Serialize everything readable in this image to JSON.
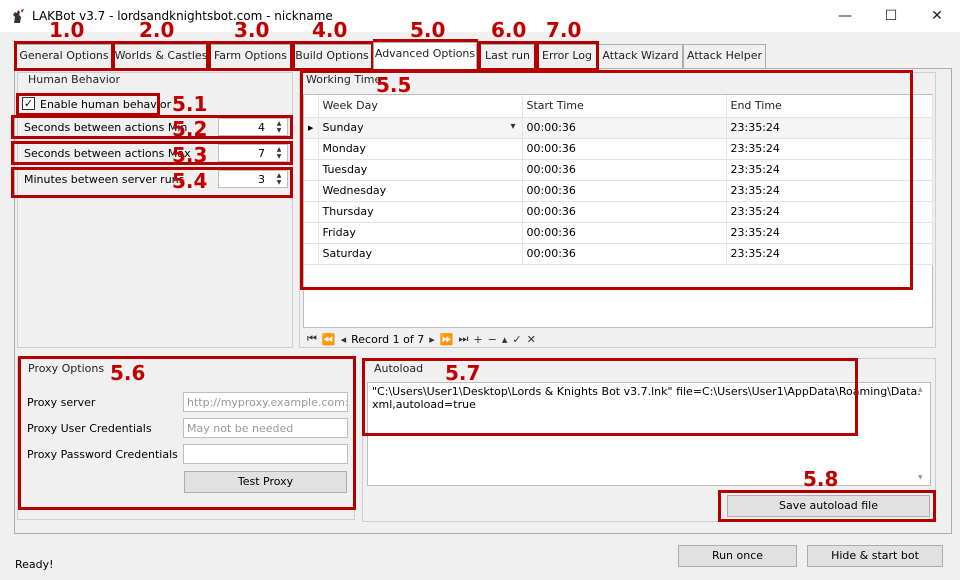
{
  "window": {
    "title": "LAKBot v3.7 - lordsandknightsbot.com - nickname",
    "minimize": "—",
    "maximize": "☐",
    "close": "✕"
  },
  "tabs": [
    {
      "label": "General Options"
    },
    {
      "label": "Worlds & Castles"
    },
    {
      "label": "Farm Options"
    },
    {
      "label": "Build Options"
    },
    {
      "label": "Advanced Options"
    },
    {
      "label": "Last run"
    },
    {
      "label": "Error Log"
    },
    {
      "label": "Attack Wizard"
    },
    {
      "label": "Attack Helper"
    }
  ],
  "annotations": [
    "1.0",
    "2.0",
    "3.0",
    "4.0",
    "5.0",
    "6.0",
    "7.0",
    "5.1",
    "5.2",
    "5.3",
    "5.4",
    "5.5",
    "5.6",
    "5.7",
    "5.8"
  ],
  "human_behavior": {
    "title": "Human Behavior",
    "enable_label": "Enable human behavior",
    "enabled": true,
    "rows": [
      {
        "label": "Seconds between actions Min",
        "value": "4"
      },
      {
        "label": "Seconds between actions Max",
        "value": "7"
      },
      {
        "label": "Minutes between server runs",
        "value": "3"
      }
    ]
  },
  "working_time": {
    "title": "Working Time",
    "columns": [
      "Week Day",
      "Start Time",
      "End Time"
    ],
    "rows": [
      {
        "day": "Sunday",
        "start": "00:00:36",
        "end": "23:35:24"
      },
      {
        "day": "Monday",
        "start": "00:00:36",
        "end": "23:35:24"
      },
      {
        "day": "Tuesday",
        "start": "00:00:36",
        "end": "23:35:24"
      },
      {
        "day": "Wednesday",
        "start": "00:00:36",
        "end": "23:35:24"
      },
      {
        "day": "Thursday",
        "start": "00:00:36",
        "end": "23:35:24"
      },
      {
        "day": "Friday",
        "start": "00:00:36",
        "end": "23:35:24"
      },
      {
        "day": "Saturday",
        "start": "00:00:36",
        "end": "23:35:24"
      }
    ],
    "record_text": "Record 1 of 7"
  },
  "proxy": {
    "title": "Proxy Options",
    "server_label": "Proxy server",
    "server_placeholder": "http://myproxy.example.com:po",
    "user_label": "Proxy User Credentials",
    "user_placeholder": "May not be needed",
    "password_label": "Proxy Password Credentials",
    "password_value": "",
    "test_button": "Test Proxy"
  },
  "autoload": {
    "title": "Autoload",
    "text": "\"C:\\Users\\User1\\Desktop\\Lords & Knights Bot v3.7.lnk\" file=C:\\Users\\User1\\AppData\\Roaming\\Data.xml,autoload=true",
    "save_button": "Save autoload file"
  },
  "footer": {
    "status": "Ready!",
    "run_once": "Run once",
    "hide_start": "Hide & start bot"
  }
}
